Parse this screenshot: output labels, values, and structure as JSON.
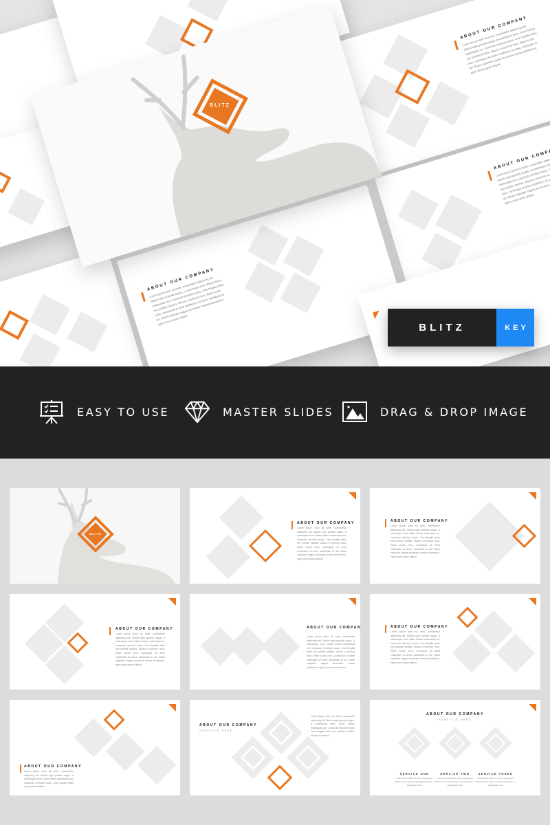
{
  "brand": {
    "accent_color": "#e87722",
    "key_color": "#1e88f5",
    "dark_color": "#222222"
  },
  "hero": {
    "title_slide_logo": "BLITZ",
    "about_heading": "ABOUT OUR COMPANY",
    "about_body": "Lorem ipsum dolor sit amet, consectetur adipiscing elit. Mauris eget gravida augue, a scelerisque enim. Etiam finibus malesuada orci, commodo tincidunt turpis. Cras fringilla tellus nec porttitor facilisis. Mauris a euismod risus. Etiam luctus nunc, consequat sit amet vestibulum sit amet, sollicitudin et dui. Etiam vulputate magna accumsan massa elementum, eget cursus quam aliquet.",
    "subtitle": "SUBTITLE HERE"
  },
  "badge": {
    "name": "BLITZ",
    "format": "KEY"
  },
  "features": [
    {
      "icon": "presentation-board-icon",
      "label": "EASY TO USE"
    },
    {
      "icon": "diamond-icon",
      "label": "MASTER SLIDES"
    },
    {
      "icon": "image-icon",
      "label": "DRAG & DROP IMAGE"
    }
  ],
  "thumbnails": [
    {
      "type": "title",
      "logo": "BLITZ"
    },
    {
      "type": "about",
      "heading": "ABOUT OUR COMPANY",
      "body": "Lorem ipsum dolor sit amet, consectetur adipiscing elit. Mauris eget gravida augue, a scelerisque enim. Etiam finibus malesuada orci, commodo tincidunt turpis. Cras fringilla tellus nec porttitor facilisis. Mauris a euismod risus. Etiam luctus nunc, consequat sit amet vestibulum sit amet, sollicitudin et dui. Etiam vulputate magna accumsan massa elementum, eget cursus quam aliquet."
    },
    {
      "type": "about",
      "heading": "ABOUT OUR COMPANY",
      "body": "Lorem ipsum dolor sit amet, consectetur adipiscing elit. Mauris eget gravida augue, a scelerisque enim. Etiam finibus malesuada orci, commodo tincidunt turpis. Cras fringilla tellus nec porttitor facilisis. Mauris a euismod risus. Etiam luctus nunc, consequat sit amet vestibulum sit amet, sollicitudin et dui. Etiam vulputate magna accumsan massa elementum, eget cursus quam aliquet."
    },
    {
      "type": "about",
      "heading": "ABOUT OUR COMPANY",
      "body": "Lorem ipsum dolor sit amet, consectetur adipiscing elit. Mauris eget gravida augue, a scelerisque enim. Etiam finibus malesuada orci, commodo tincidunt turpis. Cras fringilla tellus nec porttitor facilisis. Mauris a euismod risus. Etiam luctus nunc, consequat sit amet vestibulum sit amet, sollicitudin et dui. Etiam vulputate magna accumsan massa elementum, eget cursus quam aliquet."
    },
    {
      "type": "about",
      "heading": "ABOUT OUR COMPANY",
      "body": "Lorem ipsum dolor sit amet, consectetur adipiscing elit. Mauris eget gravida augue, a scelerisque enim. Etiam finibus malesuada orci, commodo tincidunt turpis. Cras fringilla tellus nec porttitor facilisis. Mauris a euismod risus. Etiam luctus nunc, consequat sit amet vestibulum sit amet, sollicitudin et dui. Etiam vulputate magna accumsan massa elementum, eget cursus quam aliquet."
    },
    {
      "type": "about",
      "heading": "ABOUT OUR COMPANY",
      "body": "Lorem ipsum dolor sit amet, consectetur adipiscing elit. Mauris eget gravida augue, a scelerisque enim. Etiam finibus malesuada orci, commodo tincidunt turpis. Cras fringilla tellus nec porttitor facilisis. Mauris a euismod risus. Etiam luctus nunc, consequat sit amet vestibulum sit amet, sollicitudin et dui. Etiam vulputate magna accumsan massa elementum, eget cursus quam aliquet."
    },
    {
      "type": "about",
      "heading": "ABOUT OUR COMPANY",
      "body": "Lorem ipsum dolor sit amet, consectetur adipiscing elit. Mauris eget gravida augue, a scelerisque enim. Etiam finibus malesuada orci, commodo tincidunt turpis. Cras fringilla tellus nec porttitor facilisis."
    },
    {
      "type": "about-subtitle",
      "heading": "ABOUT OUR COMPANY",
      "subtitle": "SUBTITLE HERE",
      "body": "Lorem ipsum dolor sit amet, consectetur adipiscing elit. Mauris eget gravida augue, a scelerisque enim. Etiam finibus malesuada orci, commodo tincidunt turpis. Cras fringilla tellus nec porttitor facilisis. Mauris a euismod"
    },
    {
      "type": "services",
      "heading": "ABOUT OUR COMPANY",
      "subtitle": "SUBTITLE HERE",
      "services": [
        {
          "title": "SERVICE ONE",
          "desc": "Lorem ipsum dolor sit amet, consectetur adipiscing elit. Mauris eget gravida augue, a scelerisque enim"
        },
        {
          "title": "SERVICE TWO",
          "desc": "Lorem ipsum dolor sit amet, consectetur adipiscing elit. Mauris eget gravida augue, a scelerisque enim"
        },
        {
          "title": "SERVICE THREE",
          "desc": "Lorem ipsum dolor sit amet, consectetur adipiscing elit. Mauris eget gravida augue, a scelerisque enim"
        }
      ]
    }
  ]
}
